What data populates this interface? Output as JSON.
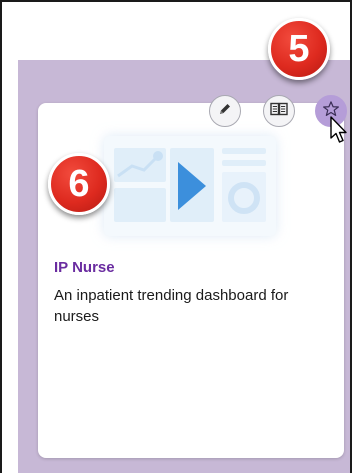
{
  "card": {
    "title": "IP Nurse",
    "description": "An inpatient trending dashboard for nurses",
    "title_color": "#6a2ca0",
    "thumbnail": "dashboard-preview-image"
  },
  "actions": [
    {
      "name": "edit-button",
      "icon": "pencil-icon"
    },
    {
      "name": "open-details-button",
      "icon": "book-icon"
    },
    {
      "name": "favorite-button",
      "icon": "star-icon",
      "state": "hover"
    }
  ],
  "callouts": {
    "five": "5",
    "six": "6"
  },
  "colors": {
    "panel": "#c7b8d6",
    "callout": "#de2a1f",
    "favorite_hover": "#b59dd8"
  }
}
